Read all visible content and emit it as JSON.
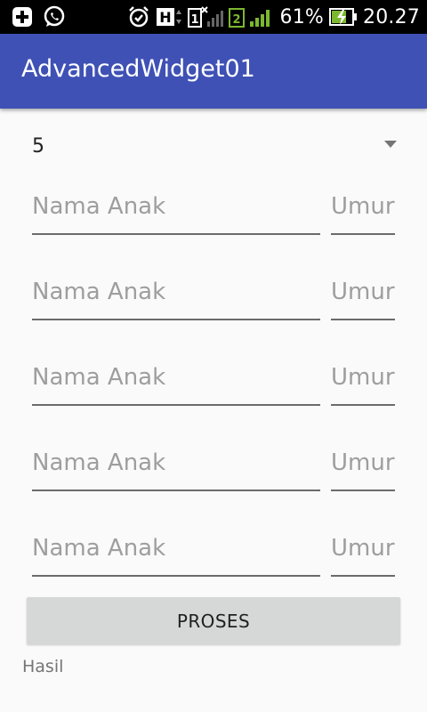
{
  "status_bar": {
    "battery": "61%",
    "time": "20.27",
    "sim1": "1",
    "sim2": "2",
    "network": "H"
  },
  "app_bar": {
    "title": "AdvancedWidget01"
  },
  "spinner": {
    "selected": "5"
  },
  "rows": [
    {
      "name_placeholder": "Nama Anak",
      "age_placeholder": "Umur"
    },
    {
      "name_placeholder": "Nama Anak",
      "age_placeholder": "Umur"
    },
    {
      "name_placeholder": "Nama Anak",
      "age_placeholder": "Umur"
    },
    {
      "name_placeholder": "Nama Anak",
      "age_placeholder": "Umur"
    },
    {
      "name_placeholder": "Nama Anak",
      "age_placeholder": "Umur"
    }
  ],
  "button": {
    "label": "PROSES"
  },
  "result": {
    "label": "Hasil"
  },
  "colors": {
    "app_bar": "#3f51b5",
    "status_bar": "#000000",
    "button_bg": "#d6d7d7",
    "signal_green": "#7cb82f"
  }
}
